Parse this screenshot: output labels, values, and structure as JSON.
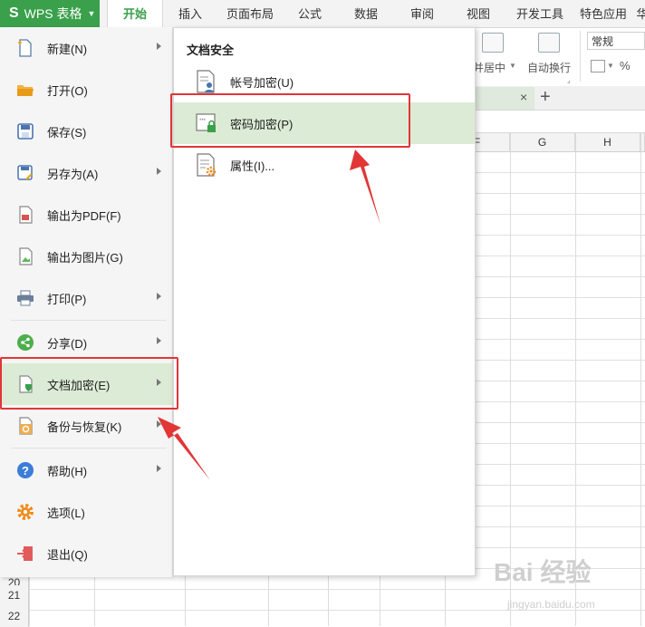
{
  "app": {
    "logo_letter": "S",
    "title": "WPS 表格"
  },
  "tabs": [
    {
      "label": "开始",
      "active": true
    },
    {
      "label": "插入"
    },
    {
      "label": "页面布局"
    },
    {
      "label": "公式"
    },
    {
      "label": "数据"
    },
    {
      "label": "审阅"
    },
    {
      "label": "视图"
    },
    {
      "label": "开发工具"
    },
    {
      "label": "特色应用"
    },
    {
      "label": "华"
    }
  ],
  "ribbon": {
    "merge_center": "并居中",
    "auto_wrap": "自动换行",
    "number_format": "常规",
    "percent": "%"
  },
  "doc_tab": {
    "close": "×",
    "add": "+"
  },
  "columns": [
    "F",
    "G",
    "H",
    ""
  ],
  "rows": [
    "20",
    "21",
    "22"
  ],
  "menu": {
    "items": [
      {
        "label": "新建(N)",
        "icon": "new-file-icon",
        "submenu": true
      },
      {
        "label": "打开(O)",
        "icon": "open-folder-icon",
        "submenu": false
      },
      {
        "label": "保存(S)",
        "icon": "save-icon",
        "submenu": false
      },
      {
        "label": "另存为(A)",
        "icon": "save-as-icon",
        "submenu": true
      },
      {
        "label": "输出为PDF(F)",
        "icon": "pdf-export-icon",
        "submenu": false
      },
      {
        "label": "输出为图片(G)",
        "icon": "image-export-icon",
        "submenu": false
      },
      {
        "label": "打印(P)",
        "icon": "printer-icon",
        "submenu": true
      },
      {
        "label": "分享(D)",
        "icon": "share-icon",
        "submenu": true
      },
      {
        "label": "文档加密(E)",
        "icon": "document-lock-icon",
        "submenu": true,
        "highlighted": true
      },
      {
        "label": "备份与恢复(K)",
        "icon": "backup-icon",
        "submenu": true
      },
      {
        "label": "帮助(H)",
        "icon": "help-icon",
        "submenu": true
      },
      {
        "label": "选项(L)",
        "icon": "gear-icon",
        "submenu": false
      },
      {
        "label": "退出(Q)",
        "icon": "exit-icon",
        "submenu": false
      }
    ]
  },
  "submenu": {
    "title": "文档安全",
    "items": [
      {
        "label": "帐号加密(U)",
        "icon": "account-encrypt-icon"
      },
      {
        "label": "密码加密(P)",
        "icon": "password-encrypt-icon",
        "highlighted": true
      },
      {
        "label": "属性(I)...",
        "icon": "properties-icon"
      }
    ]
  },
  "watermark": {
    "text": "Bai 经验",
    "sub": "jingyan.baidu.com"
  },
  "colors": {
    "accent_green": "#3aa04b",
    "highlight": "#dcebd5",
    "annotation_red": "#e23636"
  }
}
